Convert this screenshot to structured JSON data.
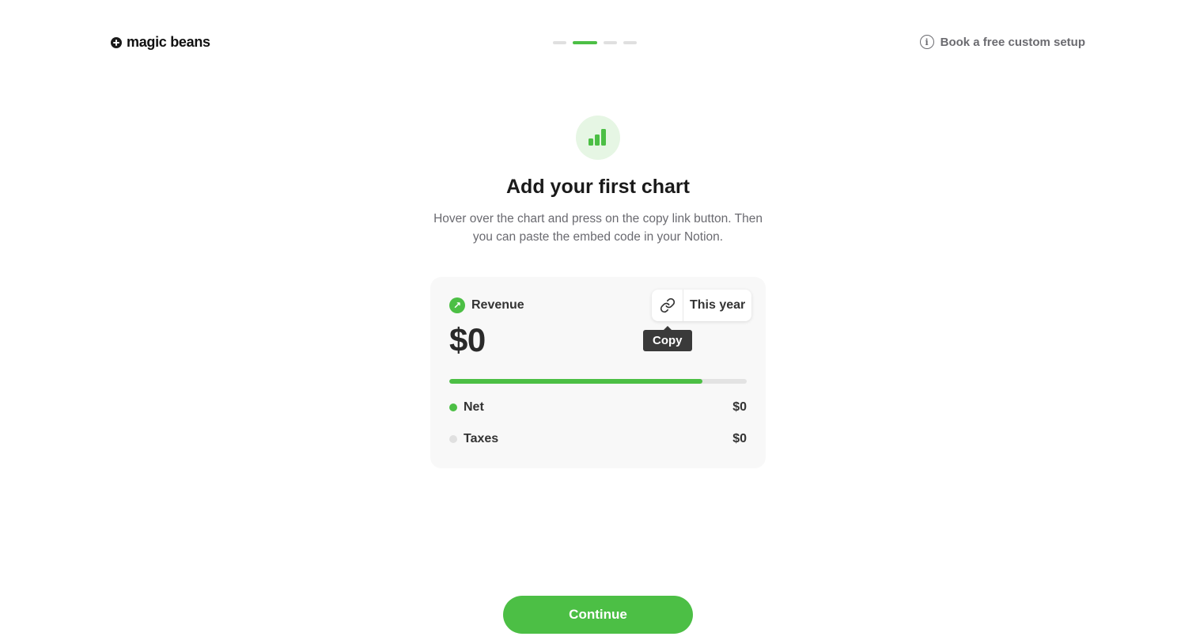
{
  "header": {
    "logo_text": "magic beans",
    "steps": [
      false,
      true,
      false,
      false
    ],
    "setup_link": "Book a free custom setup"
  },
  "hero": {
    "icon": "bar-chart-icon",
    "title": "Add your first chart",
    "subtitle": "Hover over the chart and press on the copy link button. Then you can paste the embed code in your Notion."
  },
  "card": {
    "label": "Revenue",
    "badge_icon": "arrow-up-right-icon",
    "value": "$0",
    "range_label": "This year",
    "copy_icon": "link-icon",
    "tooltip": "Copy",
    "progress_fraction": 0.85,
    "legend": [
      {
        "label": "Net",
        "value": "$0",
        "color": "#4cbf45"
      },
      {
        "label": "Taxes",
        "value": "$0",
        "color": "#e0e0e0"
      }
    ]
  },
  "continue_label": "Continue",
  "colors": {
    "accent": "#4cbf45",
    "accent_light": "#e6f6e4"
  }
}
